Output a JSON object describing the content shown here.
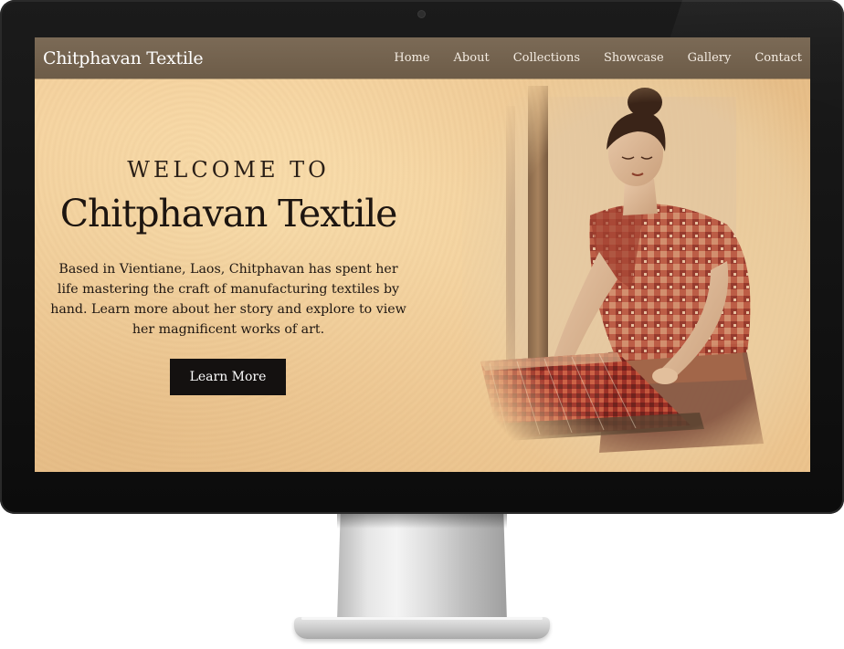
{
  "site": {
    "brand": "Chitphavan Textile",
    "nav": [
      {
        "label": "Home"
      },
      {
        "label": "About"
      },
      {
        "label": "Collections"
      },
      {
        "label": "Showcase"
      },
      {
        "label": "Gallery"
      },
      {
        "label": "Contact"
      }
    ]
  },
  "hero": {
    "welcome": "WELCOME TO",
    "title": "Chitphavan Textile",
    "body": "Based in Vientiane, Laos, Chitphavan has spent her life mastering the craft of manufacturing textiles by hand. Learn more about her story and explore to view her magnificent works of art.",
    "button_label": "Learn More"
  },
  "icons": {
    "painting": "woman-weaving-at-loom-illustration",
    "camera": "webcam-dot"
  },
  "colors": {
    "navbar": "#736250",
    "background": "#f5d3a0",
    "button": "#141110",
    "text": "#1f1712",
    "bezel": "#111111"
  }
}
